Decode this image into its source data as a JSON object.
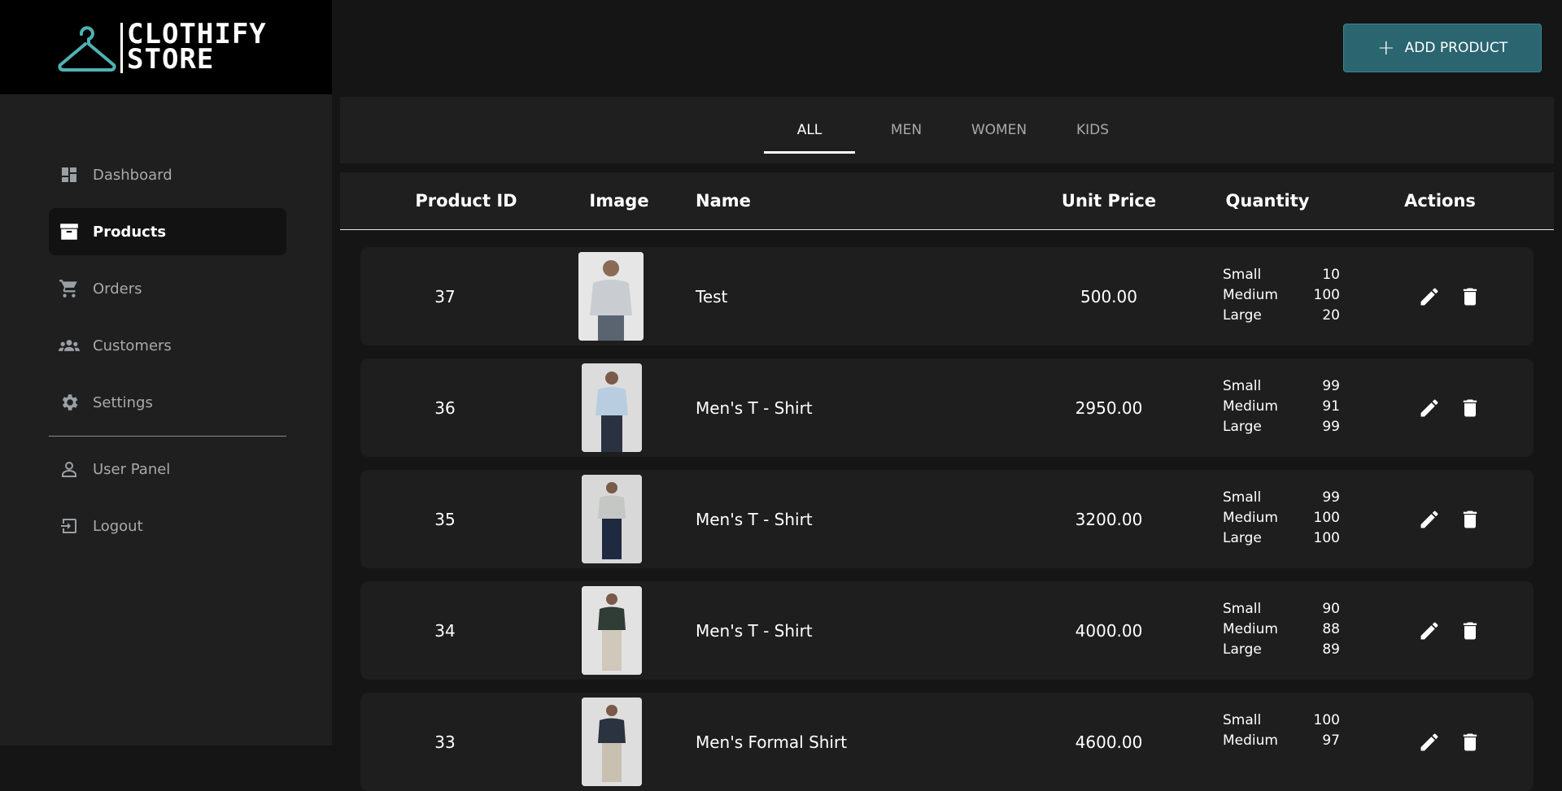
{
  "brand": {
    "line1": "CLOTHIFY",
    "line2": "STORE"
  },
  "nav": [
    {
      "label": "Dashboard",
      "icon": "dashboard-icon",
      "active": false
    },
    {
      "label": "Products",
      "icon": "archive-box-icon",
      "active": true
    },
    {
      "label": "Orders",
      "icon": "cart-icon",
      "active": false
    },
    {
      "label": "Customers",
      "icon": "people-icon",
      "active": false
    },
    {
      "label": "Settings",
      "icon": "gear-icon",
      "active": false
    },
    {
      "label": "User Panel",
      "icon": "user-icon",
      "active": false
    },
    {
      "label": "Logout",
      "icon": "logout-icon",
      "active": false
    }
  ],
  "toolbar": {
    "add_label": "ADD PRODUCT"
  },
  "tabs": [
    {
      "label": "ALL",
      "active": true
    },
    {
      "label": "MEN",
      "active": false
    },
    {
      "label": "WOMEN",
      "active": false
    },
    {
      "label": "KIDS",
      "active": false
    }
  ],
  "table": {
    "headers": [
      "Product ID",
      "Image",
      "Name",
      "Unit Price",
      "Quantity",
      "Actions"
    ],
    "size_labels": [
      "Small",
      "Medium",
      "Large"
    ],
    "rows": [
      {
        "id": "37",
        "name": "Test",
        "price": "500.00",
        "qty": [
          "10",
          "100",
          "20"
        ],
        "image": "grey t-shirt model photo"
      },
      {
        "id": "36",
        "name": "Men's T - Shirt",
        "price": "2950.00",
        "qty": [
          "99",
          "91",
          "99"
        ],
        "image": "light blue t-shirt model photo"
      },
      {
        "id": "35",
        "name": "Men's T - Shirt",
        "price": "3200.00",
        "qty": [
          "99",
          "100",
          "100"
        ],
        "image": "grey t-shirt navy pants model photo"
      },
      {
        "id": "34",
        "name": "Men's T - Shirt",
        "price": "4000.00",
        "qty": [
          "90",
          "88",
          "89"
        ],
        "image": "dark green polo model photo"
      },
      {
        "id": "33",
        "name": "Men's Formal Shirt",
        "price": "4600.00",
        "qty": [
          "100",
          "97",
          ""
        ],
        "image": "dark formal shirt model photo"
      }
    ]
  },
  "colors": {
    "accent": "#2a6570",
    "logo": "#4fb3b3",
    "background": "#151515",
    "panel": "#1f1f1f"
  }
}
